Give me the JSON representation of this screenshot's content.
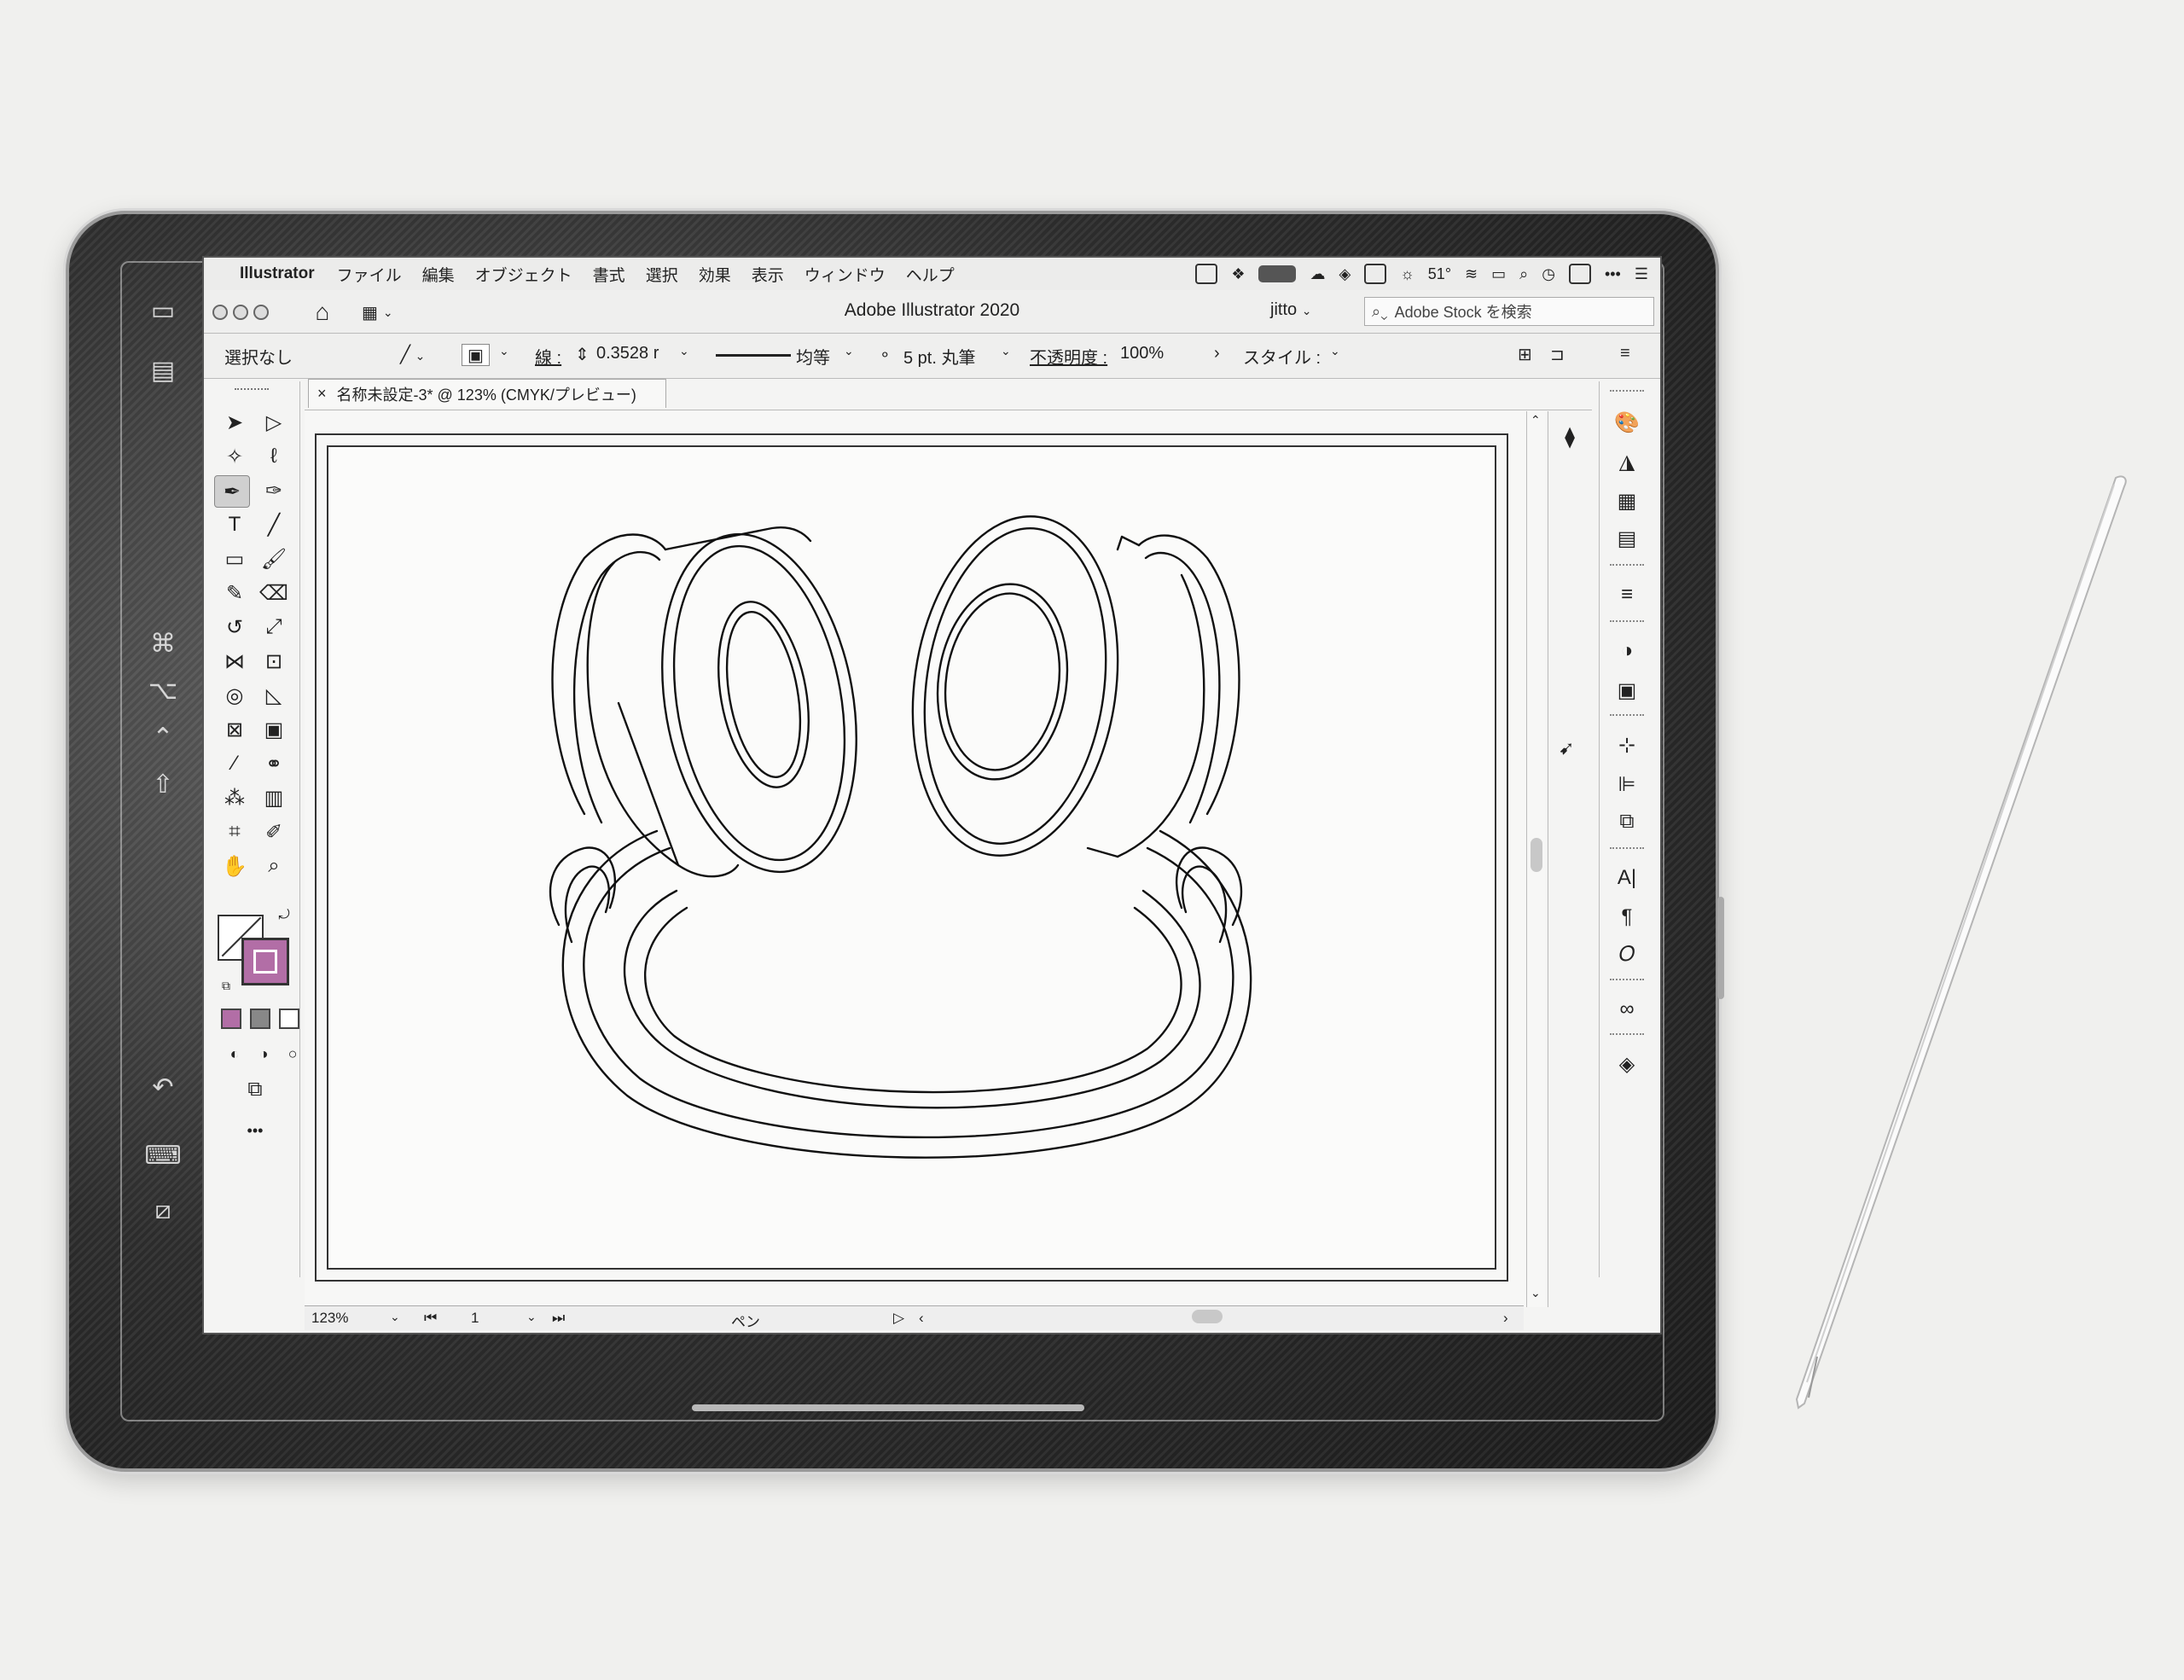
{
  "sidecar": {
    "icons": [
      "sidebar-icon",
      "menu-icon",
      "command-icon",
      "option-icon",
      "control-icon",
      "shift-icon",
      "undo-icon",
      "keyboard-icon",
      "disconnect-icon"
    ]
  },
  "menubar": {
    "apple": "",
    "app_name": "Illustrator",
    "items": [
      "ファイル",
      "編集",
      "オブジェクト",
      "書式",
      "選択",
      "効果",
      "表示",
      "ウィンドウ",
      "ヘルプ"
    ],
    "temperature": "51°"
  },
  "titlebar": {
    "title": "Adobe Illustrator 2020",
    "user": "jitto",
    "stock_placeholder": "Adobe Stock を検索"
  },
  "controlbar": {
    "selection": "選択なし",
    "stroke_label": "線 :",
    "stroke_weight": "0.3528 r",
    "profile_label": "均等",
    "brush_label": "5 pt. 丸筆",
    "opacity_label": "不透明度 :",
    "opacity_value": "100%",
    "style_label": "スタイル :"
  },
  "document": {
    "tab_title": "名称未設定-3* @ 123% (CMYK/プレビュー)",
    "close": "×"
  },
  "statusbar": {
    "zoom": "123%",
    "artboard": "1",
    "tool": "ペン"
  },
  "toolbox": {
    "more": "•••"
  },
  "colors": {
    "stroke_swatch": "#b26ea6",
    "device": "#3a3a3a"
  }
}
